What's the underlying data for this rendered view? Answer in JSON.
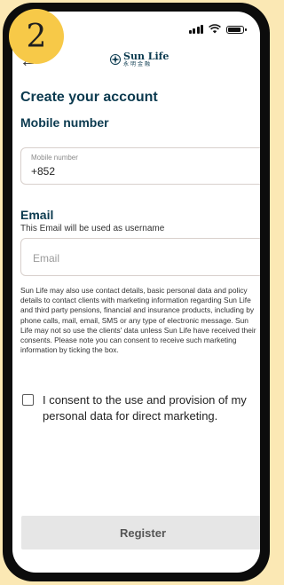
{
  "step_badge": "2",
  "header": {
    "logo_en": "Sun Life",
    "logo_zh": "永明金融"
  },
  "page": {
    "title": "Create your account"
  },
  "mobile": {
    "section_title": "Mobile number",
    "field_label": "Mobile number",
    "field_value": "+852"
  },
  "email": {
    "section_title": "Email",
    "hint": "This Email will be used as username",
    "placeholder": "Email"
  },
  "disclaimer": "Sun Life may also use contact details, basic personal data and policy details to contact clients with marketing information regarding Sun Life and third party pensions, financial and insurance products, including by phone calls, mail, email, SMS or any type of electronic message. Sun Life may not so use the clients' data unless Sun Life have received their consents. Please note you can consent to receive such marketing information by ticking the box.",
  "consent": {
    "label": "I consent to the use and provision of my personal data for direct marketing.",
    "checked": false
  },
  "register_button": "Register",
  "colors": {
    "heading": "#0b3a4f",
    "badge": "#f7c948",
    "background": "#fbe8b4",
    "button_bg": "#e6e6e6"
  },
  "icons": {
    "back": "arrow-left-icon",
    "logo": "sun-life-logo-icon",
    "signal": "signal-icon",
    "wifi": "wifi-icon",
    "battery": "battery-icon"
  }
}
